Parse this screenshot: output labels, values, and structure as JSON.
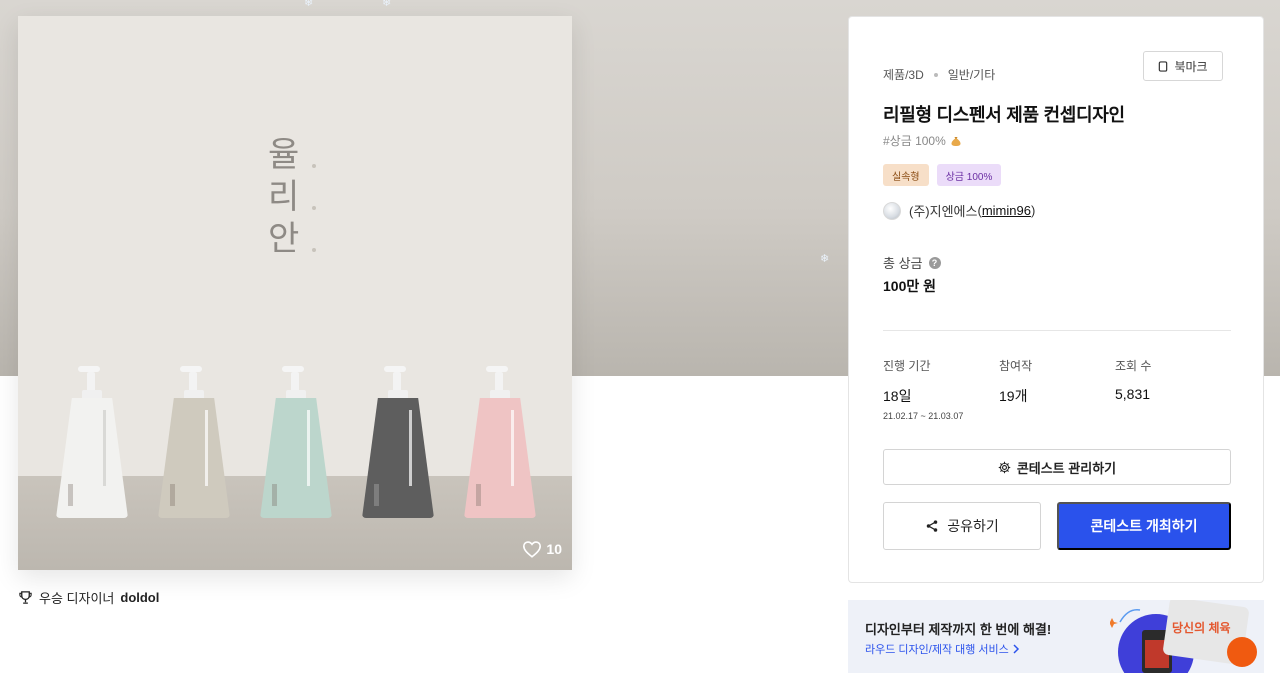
{
  "product": {
    "brand_text": [
      "율",
      "리",
      "안"
    ],
    "like_count": "10",
    "award_label": "우승 디자이너",
    "award_winner": "doldol"
  },
  "contest": {
    "category": "제품/3D",
    "subcategory": "일반/기타",
    "bookmark_label": "북마크",
    "title": "리필형 디스펜서 제품 컨셉디자인",
    "hashtag": "#상금 100%",
    "tags": [
      "실속형",
      "상금 100%"
    ],
    "host_name": "(주)지엔에스",
    "host_user": "mimin96",
    "prize_label": "총 상금",
    "prize_value": "100만 원",
    "stats": {
      "period_label": "진행 기간",
      "period_value": "18일",
      "period_range": "21.02.17 ~ 21.03.07",
      "entries_label": "참여작",
      "entries_value": "19개",
      "views_label": "조회 수",
      "views_value": "5,831"
    },
    "manage_label": "콘테스트 관리하기",
    "share_label": "공유하기",
    "host_contest_label": "콘테스트 개최하기"
  },
  "promo": {
    "title": "디자인부터 제작까지 한 번에 해결!",
    "link": "라우드 디자인/제작 대행 서비스",
    "art_text": "당신의 체육"
  },
  "colors": {
    "primary": "#2a52ec",
    "tag_practical_bg": "#f7dfc8",
    "tag_prize_bg": "#ebdcf9",
    "bottles": [
      "#f2f2f0",
      "#cfcabe",
      "#bcd6cc",
      "#5e5e5e",
      "#efc4c4"
    ]
  }
}
